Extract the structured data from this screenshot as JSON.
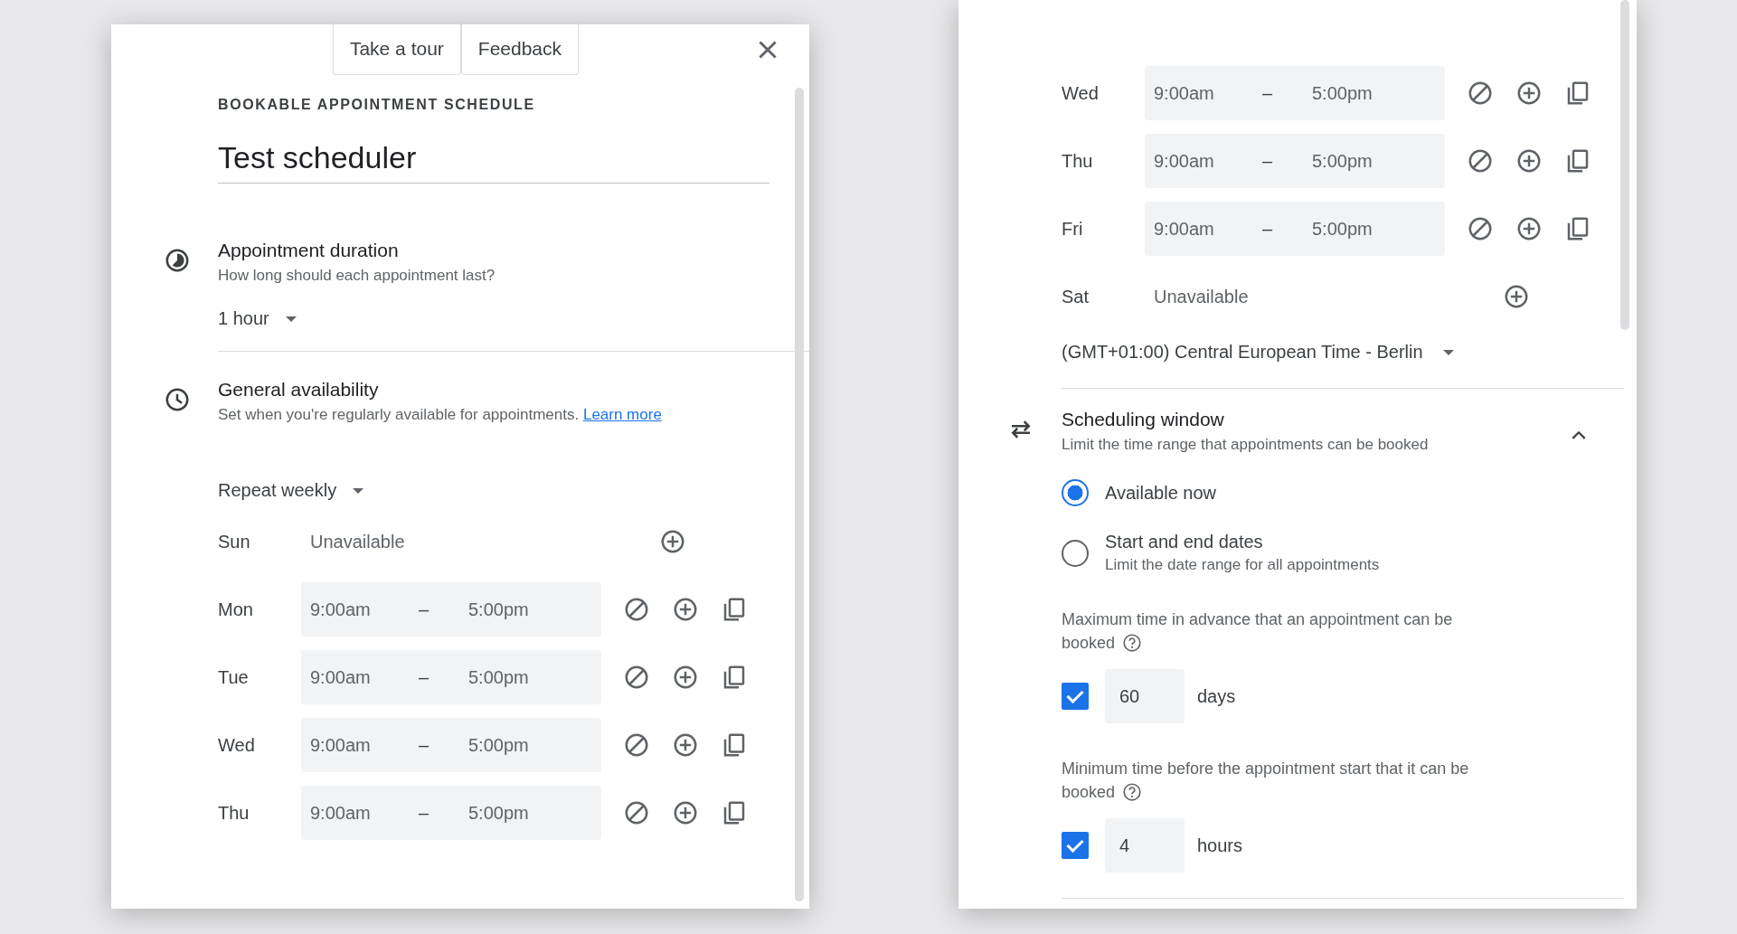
{
  "left_panel": {
    "top_buttons": [
      "Take a tour",
      "Feedback"
    ],
    "section_label": "BOOKABLE APPOINTMENT SCHEDULE",
    "title": "Test scheduler",
    "duration": {
      "heading": "Appointment duration",
      "description": "How long should each appointment last?",
      "value": "1 hour"
    },
    "availability": {
      "heading": "General availability",
      "description": "Set when you're regularly available for appointments.",
      "link": "Learn more",
      "repeat": "Repeat weekly",
      "days": [
        {
          "day": "Sun",
          "kind": "unavailable",
          "text": "Unavailable"
        },
        {
          "day": "Mon",
          "kind": "hours",
          "start": "9:00am",
          "separator": "–",
          "end": "5:00pm"
        },
        {
          "day": "Tue",
          "kind": "hours",
          "start": "9:00am",
          "separator": "–",
          "end": "5:00pm"
        },
        {
          "day": "Wed",
          "kind": "hours",
          "start": "9:00am",
          "separator": "–",
          "end": "5:00pm"
        },
        {
          "day": "Thu",
          "kind": "hours",
          "start": "9:00am",
          "separator": "–",
          "end": "5:00pm"
        }
      ]
    }
  },
  "right_panel": {
    "days": [
      {
        "day": "Wed",
        "kind": "hours",
        "start": "9:00am",
        "separator": "–",
        "end": "5:00pm"
      },
      {
        "day": "Thu",
        "kind": "hours",
        "start": "9:00am",
        "separator": "–",
        "end": "5:00pm"
      },
      {
        "day": "Fri",
        "kind": "hours",
        "start": "9:00am",
        "separator": "–",
        "end": "5:00pm"
      },
      {
        "day": "Sat",
        "kind": "unavailable",
        "text": "Unavailable"
      }
    ],
    "timezone": "(GMT+01:00) Central European Time - Berlin",
    "scheduling": {
      "heading": "Scheduling window",
      "description": "Limit the time range that appointments can be booked",
      "expanded": true,
      "options": [
        {
          "label": "Available now",
          "selected": true
        },
        {
          "label": "Start and end dates",
          "sublabel": "Limit the date range for all appointments",
          "selected": false
        }
      ],
      "limits": [
        {
          "label": "Maximum time in advance that an appointment can be",
          "label_end": "booked",
          "checked": true,
          "value": "60",
          "unit": "days"
        },
        {
          "label": "Minimum time before the appointment start that it can be",
          "label_end": "booked",
          "checked": true,
          "value": "4",
          "unit": "hours"
        }
      ]
    }
  }
}
